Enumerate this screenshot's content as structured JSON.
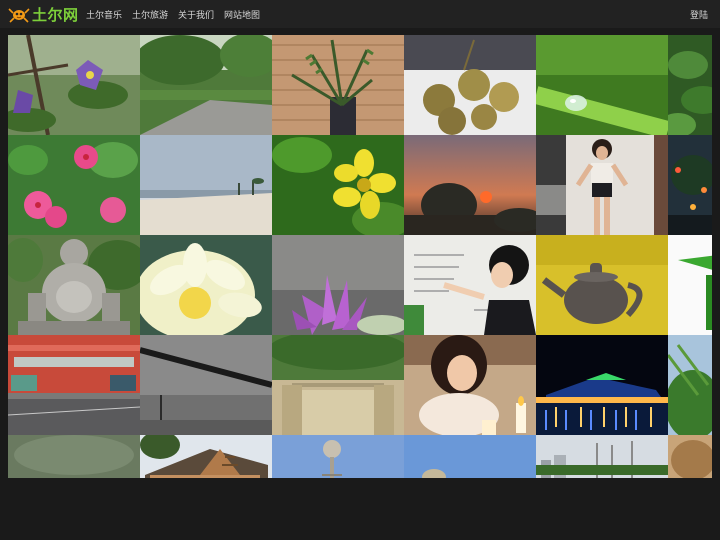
{
  "header": {
    "logo_text": "土尔网",
    "nav": [
      "土尔音乐",
      "土尔旅游",
      "关于我们",
      "网站地图"
    ],
    "login": "登陆"
  },
  "colors": {
    "topbar_bg": "#222222",
    "logo_green": "#7dcf3a",
    "page_bg": "#1a1a1a"
  },
  "tiles": [
    {
      "name": "tile-purple-eggplant-flowers"
    },
    {
      "name": "tile-park-path"
    },
    {
      "name": "tile-fern-in-pot"
    },
    {
      "name": "tile-longan-fruits"
    },
    {
      "name": "tile-water-droplet-leaf"
    },
    {
      "name": "tile-tea-plants"
    },
    {
      "name": "tile-pink-flowers"
    },
    {
      "name": "tile-beach"
    },
    {
      "name": "tile-yellow-flower"
    },
    {
      "name": "tile-sunset-tree"
    },
    {
      "name": "tile-girl-standing"
    },
    {
      "name": "tile-night-lights"
    },
    {
      "name": "tile-laughing-buddha-statue"
    },
    {
      "name": "tile-white-lotus"
    },
    {
      "name": "tile-pink-lotus"
    },
    {
      "name": "tile-girl-writing-whiteboard"
    },
    {
      "name": "tile-clay-teapot"
    },
    {
      "name": "tile-green-leaf-white"
    },
    {
      "name": "tile-street-building"
    },
    {
      "name": "tile-grey-sky-pole"
    },
    {
      "name": "tile-stone-bridge"
    },
    {
      "name": "tile-girl-candles"
    },
    {
      "name": "tile-night-harbor"
    },
    {
      "name": "tile-bamboo-sky"
    },
    {
      "name": "tile-blurred-green"
    },
    {
      "name": "tile-wooden-house"
    },
    {
      "name": "tile-tower-sky"
    },
    {
      "name": "tile-blue-sky-rock"
    },
    {
      "name": "tile-city-skyline"
    },
    {
      "name": "tile-brown-animal"
    }
  ]
}
